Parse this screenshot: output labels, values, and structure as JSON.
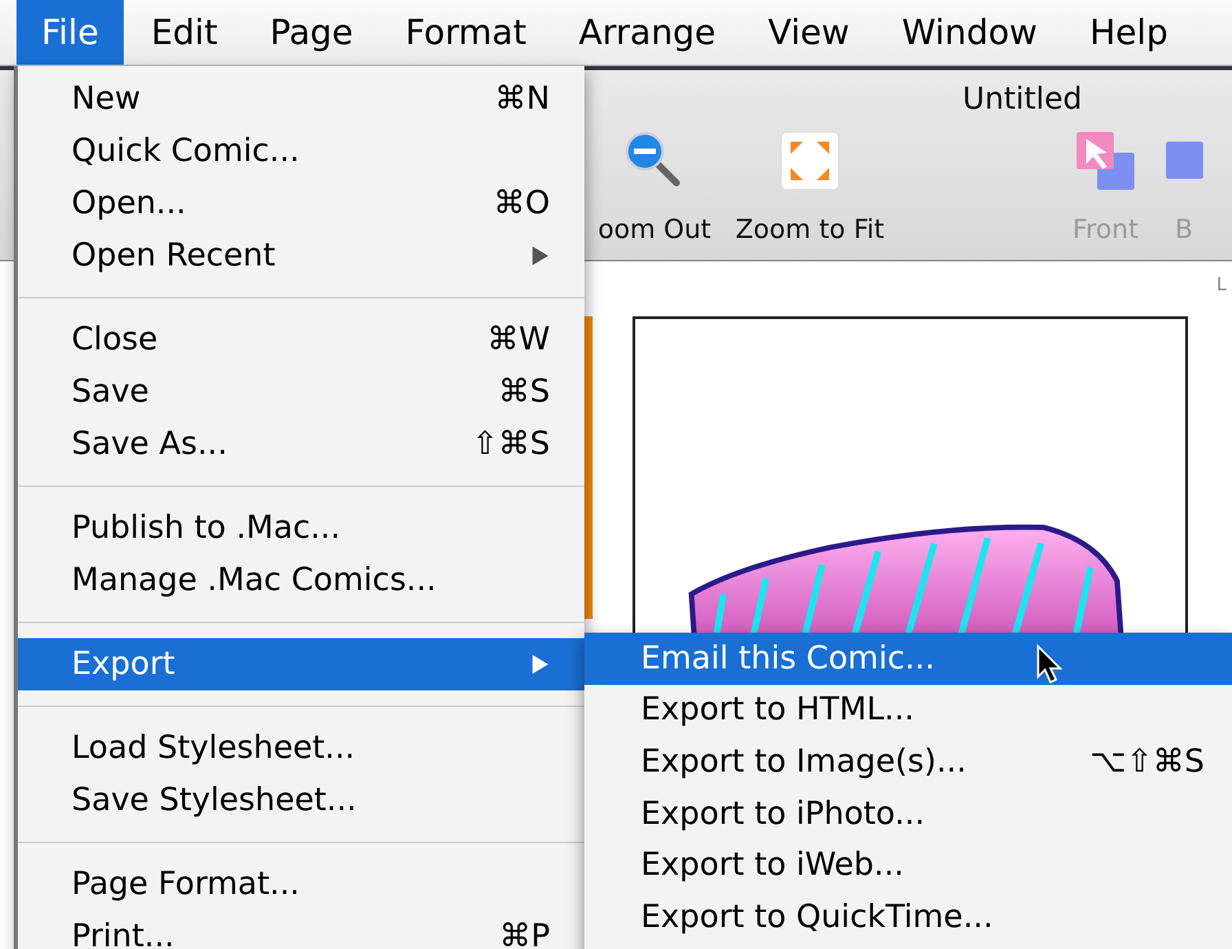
{
  "menubar": [
    {
      "label": "File",
      "selected": true
    },
    {
      "label": "Edit",
      "selected": false
    },
    {
      "label": "Page",
      "selected": false
    },
    {
      "label": "Format",
      "selected": false
    },
    {
      "label": "Arrange",
      "selected": false
    },
    {
      "label": "View",
      "selected": false
    },
    {
      "label": "Window",
      "selected": false
    },
    {
      "label": "Help",
      "selected": false
    }
  ],
  "window": {
    "title": "Untitled",
    "toolbar": [
      {
        "kind": "zoom-out",
        "label": "oom Out",
        "disabled": false
      },
      {
        "kind": "zoom-fit",
        "label": "Zoom to Fit",
        "disabled": false
      },
      {
        "kind": "front",
        "label": "Front",
        "disabled": true
      },
      {
        "kind": "back",
        "label": "B",
        "disabled": true
      }
    ],
    "side_label": "L"
  },
  "file_menu": [
    {
      "kind": "item",
      "label": "New",
      "shortcut": "⌘N",
      "submenu": false,
      "selected": false
    },
    {
      "kind": "item",
      "label": "Quick Comic...",
      "submenu": false,
      "selected": false
    },
    {
      "kind": "item",
      "label": "Open...",
      "shortcut": "⌘O",
      "submenu": false,
      "selected": false
    },
    {
      "kind": "item",
      "label": "Open Recent",
      "submenu": true,
      "selected": false
    },
    {
      "kind": "separator"
    },
    {
      "kind": "item",
      "label": "Close",
      "shortcut": "⌘W",
      "submenu": false,
      "selected": false
    },
    {
      "kind": "item",
      "label": "Save",
      "shortcut": "⌘S",
      "submenu": false,
      "selected": false
    },
    {
      "kind": "item",
      "label": "Save As...",
      "shortcut": "⇧⌘S",
      "submenu": false,
      "selected": false
    },
    {
      "kind": "separator"
    },
    {
      "kind": "item",
      "label": "Publish to .Mac...",
      "submenu": false,
      "selected": false
    },
    {
      "kind": "item",
      "label": "Manage .Mac Comics...",
      "submenu": false,
      "selected": false
    },
    {
      "kind": "separator"
    },
    {
      "kind": "item",
      "label": "Export",
      "submenu": true,
      "selected": true
    },
    {
      "kind": "separator"
    },
    {
      "kind": "item",
      "label": "Load Stylesheet...",
      "submenu": false,
      "selected": false
    },
    {
      "kind": "item",
      "label": "Save Stylesheet...",
      "submenu": false,
      "selected": false
    },
    {
      "kind": "separator"
    },
    {
      "kind": "item",
      "label": "Page Format...",
      "submenu": false,
      "selected": false
    },
    {
      "kind": "item",
      "label": "Print...",
      "shortcut": "⌘P",
      "submenu": false,
      "selected": false
    }
  ],
  "export_submenu": [
    {
      "label": "Email this Comic...",
      "selected": true
    },
    {
      "label": "Export to HTML...",
      "selected": false
    },
    {
      "label": "Export to Image(s)...",
      "shortcut": "⌥⇧⌘S",
      "selected": false
    },
    {
      "label": "Export to iPhoto...",
      "selected": false
    },
    {
      "label": "Export to iWeb...",
      "selected": false
    },
    {
      "label": "Export to QuickTime...",
      "selected": false
    }
  ]
}
